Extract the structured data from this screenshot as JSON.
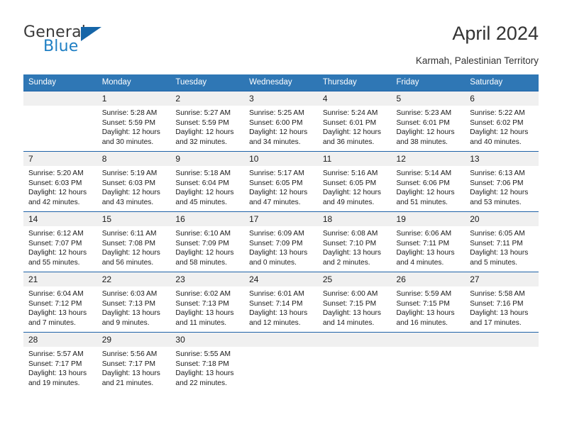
{
  "brand": {
    "name_top": "General",
    "name_bottom": "Blue",
    "triangle_color": "#1565a8",
    "blue_color": "#1f7fc4"
  },
  "header": {
    "title": "April 2024",
    "subtitle": "Karmah, Palestinian Territory"
  },
  "theme": {
    "header_bg": "#2f77b5",
    "row_border": "#1f62a8",
    "daynum_bg": "#f0f0f0"
  },
  "weekday_headers": [
    "Sunday",
    "Monday",
    "Tuesday",
    "Wednesday",
    "Thursday",
    "Friday",
    "Saturday"
  ],
  "labels": {
    "sunrise": "Sunrise:",
    "sunset": "Sunset:",
    "daylight": "Daylight:"
  },
  "weeks": [
    [
      {
        "day": "",
        "lines": []
      },
      {
        "day": "1",
        "lines": [
          "Sunrise: 5:28 AM",
          "Sunset: 5:59 PM",
          "Daylight: 12 hours",
          "and 30 minutes."
        ]
      },
      {
        "day": "2",
        "lines": [
          "Sunrise: 5:27 AM",
          "Sunset: 5:59 PM",
          "Daylight: 12 hours",
          "and 32 minutes."
        ]
      },
      {
        "day": "3",
        "lines": [
          "Sunrise: 5:25 AM",
          "Sunset: 6:00 PM",
          "Daylight: 12 hours",
          "and 34 minutes."
        ]
      },
      {
        "day": "4",
        "lines": [
          "Sunrise: 5:24 AM",
          "Sunset: 6:01 PM",
          "Daylight: 12 hours",
          "and 36 minutes."
        ]
      },
      {
        "day": "5",
        "lines": [
          "Sunrise: 5:23 AM",
          "Sunset: 6:01 PM",
          "Daylight: 12 hours",
          "and 38 minutes."
        ]
      },
      {
        "day": "6",
        "lines": [
          "Sunrise: 5:22 AM",
          "Sunset: 6:02 PM",
          "Daylight: 12 hours",
          "and 40 minutes."
        ]
      }
    ],
    [
      {
        "day": "7",
        "lines": [
          "Sunrise: 5:20 AM",
          "Sunset: 6:03 PM",
          "Daylight: 12 hours",
          "and 42 minutes."
        ]
      },
      {
        "day": "8",
        "lines": [
          "Sunrise: 5:19 AM",
          "Sunset: 6:03 PM",
          "Daylight: 12 hours",
          "and 43 minutes."
        ]
      },
      {
        "day": "9",
        "lines": [
          "Sunrise: 5:18 AM",
          "Sunset: 6:04 PM",
          "Daylight: 12 hours",
          "and 45 minutes."
        ]
      },
      {
        "day": "10",
        "lines": [
          "Sunrise: 5:17 AM",
          "Sunset: 6:05 PM",
          "Daylight: 12 hours",
          "and 47 minutes."
        ]
      },
      {
        "day": "11",
        "lines": [
          "Sunrise: 5:16 AM",
          "Sunset: 6:05 PM",
          "Daylight: 12 hours",
          "and 49 minutes."
        ]
      },
      {
        "day": "12",
        "lines": [
          "Sunrise: 5:14 AM",
          "Sunset: 6:06 PM",
          "Daylight: 12 hours",
          "and 51 minutes."
        ]
      },
      {
        "day": "13",
        "lines": [
          "Sunrise: 6:13 AM",
          "Sunset: 7:06 PM",
          "Daylight: 12 hours",
          "and 53 minutes."
        ]
      }
    ],
    [
      {
        "day": "14",
        "lines": [
          "Sunrise: 6:12 AM",
          "Sunset: 7:07 PM",
          "Daylight: 12 hours",
          "and 55 minutes."
        ]
      },
      {
        "day": "15",
        "lines": [
          "Sunrise: 6:11 AM",
          "Sunset: 7:08 PM",
          "Daylight: 12 hours",
          "and 56 minutes."
        ]
      },
      {
        "day": "16",
        "lines": [
          "Sunrise: 6:10 AM",
          "Sunset: 7:09 PM",
          "Daylight: 12 hours",
          "and 58 minutes."
        ]
      },
      {
        "day": "17",
        "lines": [
          "Sunrise: 6:09 AM",
          "Sunset: 7:09 PM",
          "Daylight: 13 hours",
          "and 0 minutes."
        ]
      },
      {
        "day": "18",
        "lines": [
          "Sunrise: 6:08 AM",
          "Sunset: 7:10 PM",
          "Daylight: 13 hours",
          "and 2 minutes."
        ]
      },
      {
        "day": "19",
        "lines": [
          "Sunrise: 6:06 AM",
          "Sunset: 7:11 PM",
          "Daylight: 13 hours",
          "and 4 minutes."
        ]
      },
      {
        "day": "20",
        "lines": [
          "Sunrise: 6:05 AM",
          "Sunset: 7:11 PM",
          "Daylight: 13 hours",
          "and 5 minutes."
        ]
      }
    ],
    [
      {
        "day": "21",
        "lines": [
          "Sunrise: 6:04 AM",
          "Sunset: 7:12 PM",
          "Daylight: 13 hours",
          "and 7 minutes."
        ]
      },
      {
        "day": "22",
        "lines": [
          "Sunrise: 6:03 AM",
          "Sunset: 7:13 PM",
          "Daylight: 13 hours",
          "and 9 minutes."
        ]
      },
      {
        "day": "23",
        "lines": [
          "Sunrise: 6:02 AM",
          "Sunset: 7:13 PM",
          "Daylight: 13 hours",
          "and 11 minutes."
        ]
      },
      {
        "day": "24",
        "lines": [
          "Sunrise: 6:01 AM",
          "Sunset: 7:14 PM",
          "Daylight: 13 hours",
          "and 12 minutes."
        ]
      },
      {
        "day": "25",
        "lines": [
          "Sunrise: 6:00 AM",
          "Sunset: 7:15 PM",
          "Daylight: 13 hours",
          "and 14 minutes."
        ]
      },
      {
        "day": "26",
        "lines": [
          "Sunrise: 5:59 AM",
          "Sunset: 7:15 PM",
          "Daylight: 13 hours",
          "and 16 minutes."
        ]
      },
      {
        "day": "27",
        "lines": [
          "Sunrise: 5:58 AM",
          "Sunset: 7:16 PM",
          "Daylight: 13 hours",
          "and 17 minutes."
        ]
      }
    ],
    [
      {
        "day": "28",
        "lines": [
          "Sunrise: 5:57 AM",
          "Sunset: 7:17 PM",
          "Daylight: 13 hours",
          "and 19 minutes."
        ]
      },
      {
        "day": "29",
        "lines": [
          "Sunrise: 5:56 AM",
          "Sunset: 7:17 PM",
          "Daylight: 13 hours",
          "and 21 minutes."
        ]
      },
      {
        "day": "30",
        "lines": [
          "Sunrise: 5:55 AM",
          "Sunset: 7:18 PM",
          "Daylight: 13 hours",
          "and 22 minutes."
        ]
      },
      {
        "day": "",
        "lines": []
      },
      {
        "day": "",
        "lines": []
      },
      {
        "day": "",
        "lines": []
      },
      {
        "day": "",
        "lines": []
      }
    ]
  ]
}
